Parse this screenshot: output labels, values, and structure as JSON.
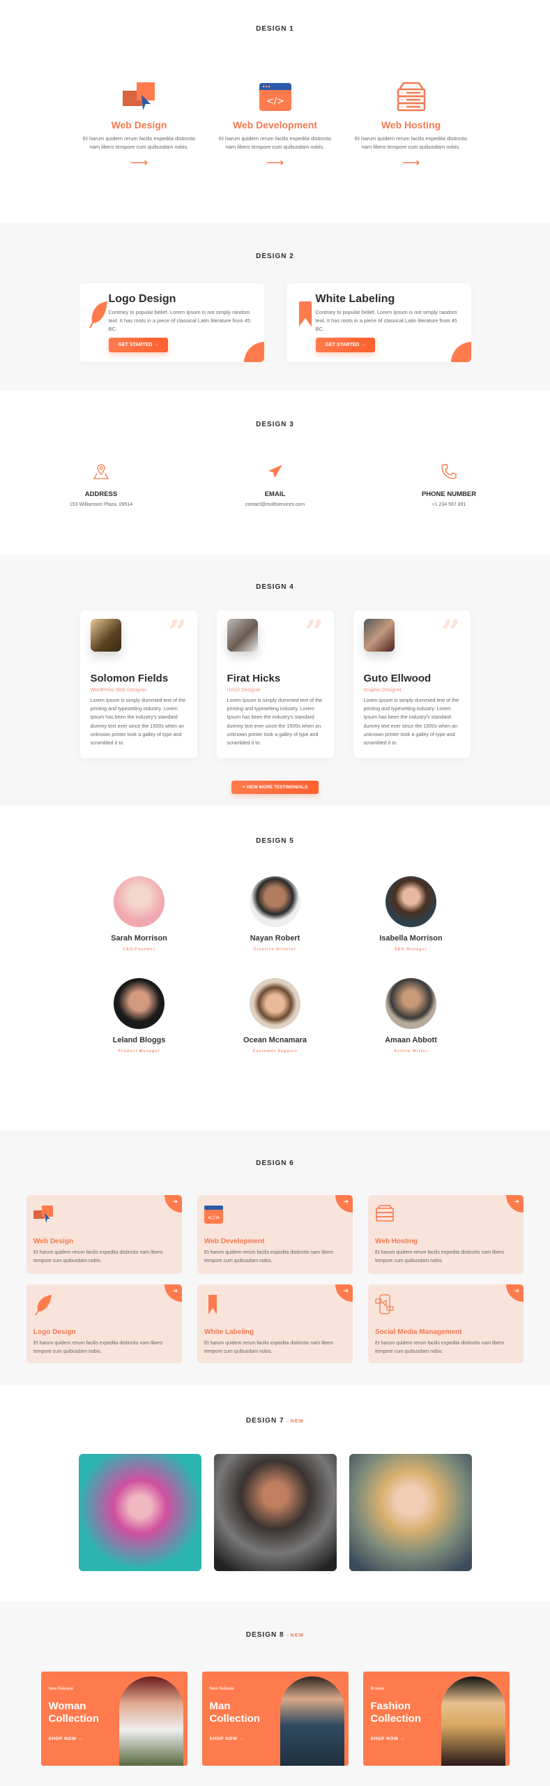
{
  "colors": {
    "accent": "#f47a50",
    "light_accent": "#f9e4dc",
    "code_blue": "#2b5aa8"
  },
  "design1": {
    "title": "DESIGN 1",
    "items": [
      {
        "icon": "web-design-icon",
        "title": "Web Design",
        "text": "Et harum quidem rerum facilis expedita distinctio nam libero tempore cum quibusdam nobis.",
        "arrow": "⟶"
      },
      {
        "icon": "code-window-icon",
        "title": "Web Development",
        "text": "Et harum quidem rerum facilis expedita distinctio nam libero tempore cum quibusdam nobis.",
        "arrow": "⟶"
      },
      {
        "icon": "server-icon",
        "title": "Web Hosting",
        "text": "Et harum quidem rerum facilis expedita distinctio nam libero tempore cum quibusdam nobis.",
        "arrow": "⟶"
      }
    ]
  },
  "design2": {
    "title": "DESIGN 2",
    "items": [
      {
        "icon": "feather-icon",
        "title": "Logo Design",
        "text": "Contrary to popular belief, Lorem Ipsum is not simply random text. It has roots in a piece of classical Latin literature from 45 BC.",
        "button": "GET STARTED →"
      },
      {
        "icon": "bookmark-icon",
        "title": "White Labeling",
        "text": "Contrary to popular belief, Lorem Ipsum is not simply random text. It has roots in a piece of classical Latin literature from 45 BC.",
        "button": "GET STARTED →"
      }
    ]
  },
  "design3": {
    "title": "DESIGN 3",
    "items": [
      {
        "icon": "map-pin-icon",
        "label": "ADDRESS",
        "value": "153 Williamson Plaza, 09514"
      },
      {
        "icon": "paper-plane-icon",
        "label": "EMAIL",
        "value": "contact@moltiservices.com"
      },
      {
        "icon": "phone-icon",
        "label": "PHONE NUMBER",
        "value": "+1 234 567 891"
      }
    ]
  },
  "design4": {
    "title": "DESIGN 4",
    "button": "+ VIEW MORE TESTIMONIALS",
    "items": [
      {
        "name": "Solomon Fields",
        "role": "WordPress Web Designer",
        "text": "Lorem Ipsum is simply dummied text of the printing and typesetting industry. Lorem Ipsum has been the industry's standard dummy text ever since the 1500s when an unknown printer took a galley of type and scrambled it to."
      },
      {
        "name": "Firat Hicks",
        "role": "UI/UX Designer",
        "text": "Lorem Ipsum is simply dummied text of the printing and typesetting industry. Lorem Ipsum has been the industry's standard dummy text ever since the 1500s when an unknown printer took a galley of type and scrambled it to."
      },
      {
        "name": "Guto Ellwood",
        "role": "Graphic Designer",
        "text": "Lorem Ipsum is simply dummied text of the printing and typesetting industry. Lorem Ipsum has been the industry's standard dummy text ever since the 1500s when an unknown printer took a galley of type and scrambled it to."
      }
    ]
  },
  "design5": {
    "title": "DESIGN 5",
    "members": [
      {
        "name": "Sarah Morrison",
        "role": "CEO/Founder"
      },
      {
        "name": "Nayan Robert",
        "role": "Creative Director"
      },
      {
        "name": "Isabella Morrison",
        "role": "SEO Manager"
      },
      {
        "name": "Leland Bloggs",
        "role": "Product Manager"
      },
      {
        "name": "Ocean Mcnamara",
        "role": "Customer Support"
      },
      {
        "name": "Amaan Abbott",
        "role": "Aritcle Writer"
      }
    ]
  },
  "design6": {
    "title": "DESIGN 6",
    "items": [
      {
        "icon": "web-design-icon",
        "title": "Web Design",
        "text": "Et harum quidem rerum facilis expedita distinctio nam libero tempore cum quibusdam nobis."
      },
      {
        "icon": "code-window-icon",
        "title": "Web Development",
        "text": "Et harum quidem rerum facilis expedita distinctio nam libero tempore cum quibusdam nobis."
      },
      {
        "icon": "server-icon",
        "title": "Web Hosting",
        "text": "Et harum quidem rerum facilis expedita distinctio nam libero tempore cum quibusdam nobis."
      },
      {
        "icon": "feather-icon",
        "title": "Logo Design",
        "text": "Et harum quidem rerum facilis expedita distinctio nam libero tempore cum quibusdam nobis."
      },
      {
        "icon": "bookmark-icon",
        "title": "White Labeling",
        "text": "Et harum quidem rerum facilis expedita distinctio nam libero tempore cum quibusdam nobis."
      },
      {
        "icon": "social-phone-icon",
        "title": "Social Media Management",
        "text": "Et harum quidem rerum facilis expedita distinctio nam libero tempore cum quibusdam nobis."
      }
    ],
    "corner_arrow": "➜"
  },
  "design7": {
    "title": "DESIGN 7",
    "badge": "- NEW"
  },
  "design8": {
    "title": "DESIGN 8",
    "badge": "- NEW",
    "items": [
      {
        "eyebrow": "New Release",
        "title": "Woman Collection",
        "link": "SHOP NOW →"
      },
      {
        "eyebrow": "New Release",
        "title": "Man Collection",
        "link": "SHOP NOW →"
      },
      {
        "eyebrow": "Browse",
        "title": "Fashion Collection",
        "link": "SHOP NOW →"
      }
    ]
  }
}
